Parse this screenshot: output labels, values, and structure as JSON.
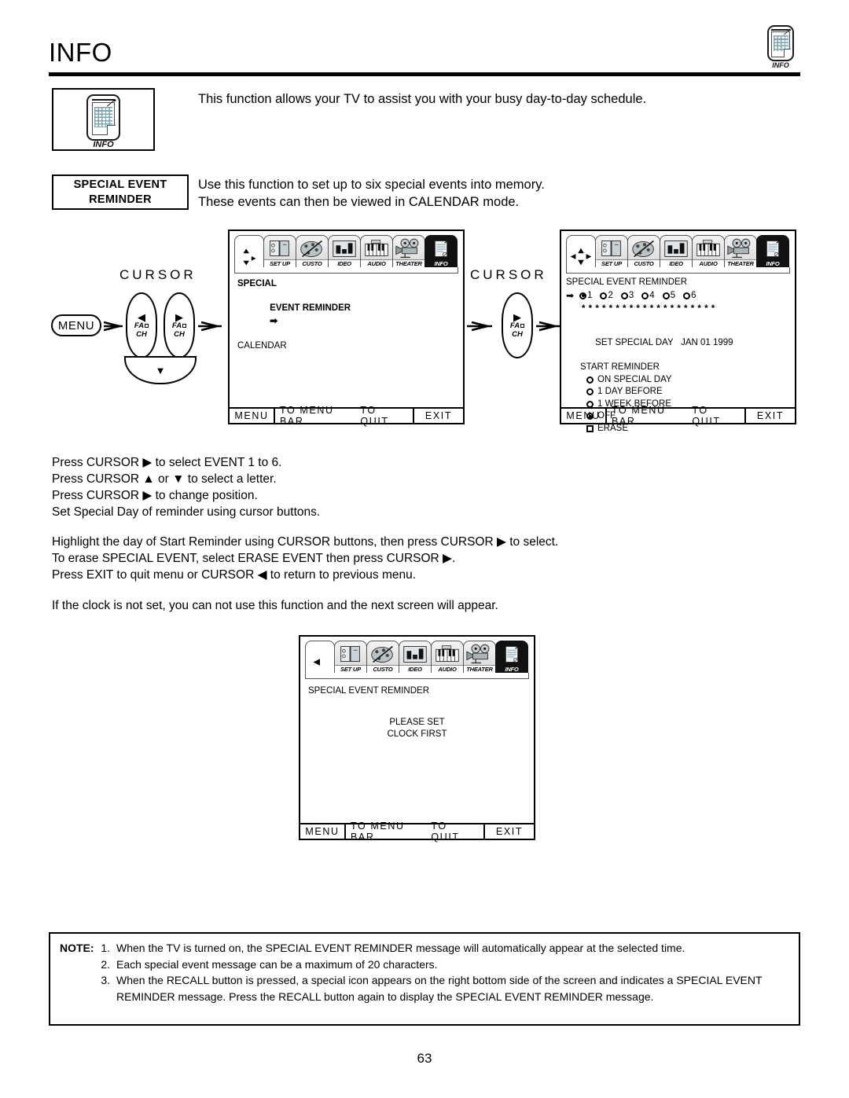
{
  "page": {
    "title": "INFO",
    "number": "63",
    "header_icon": {
      "name": "info-icon",
      "label": "INFO"
    }
  },
  "intro": {
    "icon_label": "INFO",
    "text": "This function allows your TV to assist you with your busy day-to-day schedule."
  },
  "feature": {
    "caption_line1": "SPECIAL EVENT",
    "caption_line2": "REMINDER",
    "desc_line1": "Use this function to set up to six special events into memory.",
    "desc_line2": "These events can then be viewed in CALENDAR mode."
  },
  "flow": {
    "cursor_label_1": "CURSOR",
    "cursor_label_2": "CURSOR",
    "menu_button": "MENU",
    "key_left": {
      "glyph": "◀",
      "fa": "FA",
      "ch": "CH"
    },
    "key_right": {
      "glyph": "▶",
      "fa": "FA",
      "ch": "CH"
    },
    "key_right_2": {
      "glyph": "▶",
      "fa": "FA",
      "ch": "CH"
    },
    "key_down": {
      "glyph": "▼"
    }
  },
  "menu_bar": {
    "tabs": [
      {
        "name": "setup",
        "label": "SET UP",
        "active": false
      },
      {
        "name": "custom",
        "label": "CUSTO",
        "active": false
      },
      {
        "name": "video",
        "label": "IDEO",
        "active": false
      },
      {
        "name": "audio",
        "label": "AUDIO",
        "active": false
      },
      {
        "name": "theater",
        "label": "THEATER",
        "active": false
      },
      {
        "name": "info",
        "label": "INFO",
        "active": true
      }
    ]
  },
  "osd_footer": {
    "menu": "MENU",
    "to_menu_bar": "TO MENU BAR",
    "to_quit": "TO QUIT",
    "exit": "EXIT"
  },
  "osd1": {
    "nav_glyphs": "up-right-down-arrows",
    "line1": "SPECIAL",
    "line2": "EVENT REMINDER",
    "line2_arrow": "➡",
    "line3": "CALENDAR"
  },
  "osd2": {
    "nav_glyphs": "four-way-arrows",
    "heading": "SPECIAL EVENT REMINDER",
    "selector_arrow": "➡",
    "events": [
      {
        "label": "1",
        "selected": true
      },
      {
        "label": "2",
        "selected": false
      },
      {
        "label": "3",
        "selected": false
      },
      {
        "label": "4",
        "selected": false
      },
      {
        "label": "5",
        "selected": false
      },
      {
        "label": "6",
        "selected": false
      }
    ],
    "message_placeholder": "* * * * * * * * * * * * * * * * * * * *",
    "set_special_day_label": "SET SPECIAL DAY",
    "set_special_day_value": "JAN 01 1999",
    "start_reminder_label": "START REMINDER",
    "options": [
      {
        "label": "ON SPECIAL DAY",
        "type": "radio",
        "selected": false
      },
      {
        "label": "1 DAY BEFORE",
        "type": "radio",
        "selected": false
      },
      {
        "label": "1 WEEK BEFORE",
        "type": "radio",
        "selected": false
      },
      {
        "label": "OFF",
        "type": "radio",
        "selected": true
      },
      {
        "label": "ERASE",
        "type": "checkbox",
        "selected": false
      }
    ]
  },
  "osd3": {
    "nav_glyph": "◀",
    "heading": "SPECIAL EVENT REMINDER",
    "message_line1": "PLEASE SET",
    "message_line2": "CLOCK FIRST"
  },
  "instructions": {
    "block1": [
      "Press CURSOR ▶ to select EVENT 1 to 6.",
      "Press CURSOR ▲ or ▼ to select a letter.",
      "Press CURSOR ▶ to change position.",
      "Set Special Day of reminder using cursor buttons."
    ],
    "block2": [
      "Highlight the day of Start Reminder using CURSOR buttons, then press CURSOR ▶ to select.",
      "To erase SPECIAL EVENT, select ERASE EVENT then press CURSOR ▶.",
      "Press EXIT to quit menu or CURSOR ◀ to return to previous menu."
    ],
    "clock_note": "If the clock is not set, you can not use this function and the next screen will appear."
  },
  "note": {
    "label": "NOTE:",
    "items": [
      {
        "num": "1.",
        "text": "When the TV is turned on, the SPECIAL EVENT REMINDER message will automatically appear at the selected time."
      },
      {
        "num": "2.",
        "text": "Each special event message can be a maximum of 20 characters."
      },
      {
        "num": "3.",
        "text": "When the RECALL button is pressed, a special icon appears on the right bottom side of the screen and indicates a SPECIAL EVENT REMINDER message. Press the RECALL button again to display the SPECIAL EVENT REMINDER message."
      }
    ]
  },
  "colors": {
    "ink": "#000000",
    "paper": "#ffffff",
    "icon_tint": "#7fa6b0",
    "tab_gray": "#d8d8d8"
  }
}
